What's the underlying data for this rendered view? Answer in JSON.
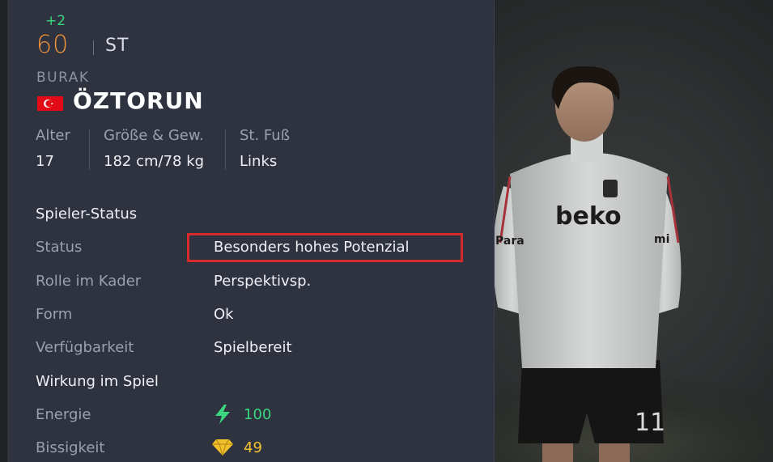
{
  "header": {
    "rating_change": "+2",
    "overall": "60",
    "position": "ST",
    "first_name": "BURAK",
    "last_name": "ÖZTORUN",
    "nation_icon": "turkey-flag-icon"
  },
  "bio": {
    "age_label": "Alter",
    "age_value": "17",
    "size_label": "Größe & Gew.",
    "size_value": "182 cm/78 kg",
    "foot_label": "St. Fuß",
    "foot_value": "Links"
  },
  "status_section": {
    "title": "Spieler-Status",
    "rows": [
      {
        "label": "Status",
        "value": "Besonders hohes Potenzial"
      },
      {
        "label": "Rolle im Kader",
        "value": "Perspektivsp."
      },
      {
        "label": "Form",
        "value": "Ok"
      },
      {
        "label": "Verfügbarkeit",
        "value": "Spielbereit"
      }
    ]
  },
  "impact_section": {
    "title": "Wirkung im Spiel",
    "energy_label": "Energie",
    "energy_value": "100",
    "energy_icon": "lightning-icon",
    "sharpness_label": "Bissigkeit",
    "sharpness_value": "49",
    "sharpness_icon": "diamond-icon"
  },
  "colors": {
    "panel": "#2f3340",
    "rating": "#f0933a",
    "positive": "#39d67e",
    "gold": "#f2c12e",
    "highlight": "#d62a2a"
  },
  "player_render": {
    "sponsor": "beko",
    "side_sponsor_left": "Para",
    "side_sponsor_right": "mi",
    "shorts_number": "11"
  }
}
